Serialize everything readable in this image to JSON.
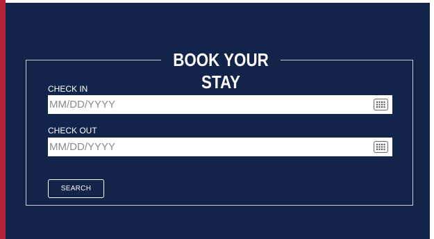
{
  "booking": {
    "title": "BOOK YOUR STAY",
    "check_in": {
      "label": "CHECK IN",
      "placeholder": "MM/DD/YYYY",
      "value": ""
    },
    "check_out": {
      "label": "CHECK OUT",
      "placeholder": "MM/DD/YYYY",
      "value": ""
    },
    "search_label": "SEARCH"
  },
  "icons": {
    "calendar": "calendar-icon"
  },
  "colors": {
    "panel_background": "#13244b",
    "accent": "#b5223a",
    "text": "#ffffff"
  }
}
